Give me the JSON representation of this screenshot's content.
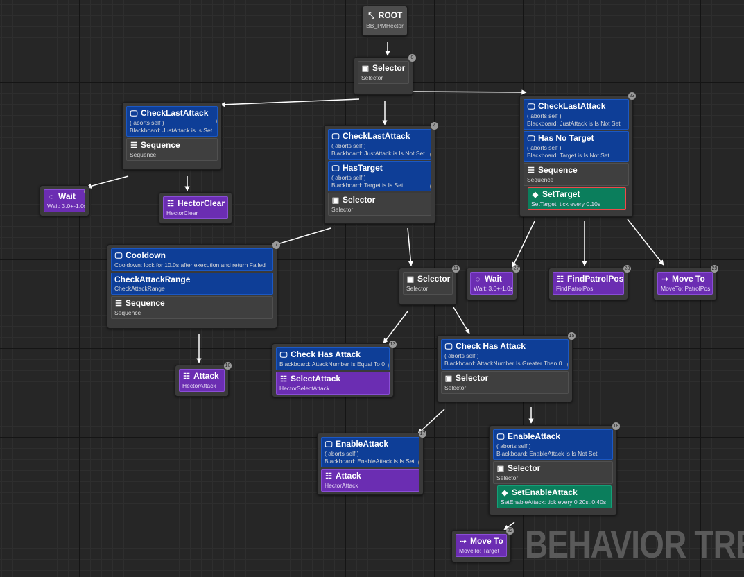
{
  "watermark": "BEHAVIOR TREE",
  "icons": {
    "root": "root-arrows-icon",
    "decorator": "monitor-icon",
    "selector": "selector-box-icon",
    "sequence": "sequence-bars-icon",
    "wait": "spinner-icon",
    "task": "task-list-icon",
    "move": "dotted-arrow-icon",
    "service": "service-icon"
  },
  "colors": {
    "decorator": "#0e3e97",
    "task": "#6b2db2",
    "service": "#0b7e5c",
    "composite": "#3f3f3f"
  },
  "nodes": {
    "root": {
      "title": "ROOT",
      "sub": "BB_PMHector"
    },
    "sel0": {
      "title": "Selector",
      "sub": "Selector",
      "badge": "0"
    },
    "left": {
      "d1": {
        "title": "CheckLastAttack",
        "aborts": "( aborts self )",
        "sub": "Blackboard: JustAttack is Is Set",
        "badge": "1"
      },
      "comp": {
        "title": "Sequence",
        "sub": "Sequence"
      }
    },
    "wait1": {
      "title": "Wait",
      "sub": "Wait: 3.0+-1.0s",
      "badge": "2"
    },
    "hectorclear": {
      "title": "HectorClear",
      "sub": "HectorClear",
      "badge": "3"
    },
    "mid": {
      "d1": {
        "title": "CheckLastAttack",
        "aborts": "( aborts self )",
        "sub": "Blackboard: JustAttack is Is Not Set",
        "badge": "5"
      },
      "d2": {
        "title": "HasTarget",
        "aborts": "( aborts self )",
        "sub": "Blackboard: Target is Is Set",
        "badge": "6"
      },
      "comp": {
        "title": "Selector",
        "sub": "Selector",
        "badge": "4"
      }
    },
    "cool": {
      "d1": {
        "title": "Cooldown",
        "sub": "Cooldown: lock for 10.0s after execution and return Failed",
        "badge": "8"
      },
      "d2": {
        "title": "CheckAttackRange",
        "sub": "CheckAttackRange",
        "badge": "9"
      },
      "comp": {
        "title": "Sequence",
        "sub": "Sequence",
        "badge": "7"
      }
    },
    "attack1": {
      "title": "Attack",
      "sub": "HectorAttack",
      "badge": "10"
    },
    "sel2": {
      "title": "Selector",
      "sub": "Selector",
      "badge": "11"
    },
    "cha1": {
      "d1": {
        "title": "Check Has Attack",
        "sub": "Blackboard: AttackNumber Is Equal To 0",
        "badge": "13"
      },
      "task": {
        "title": "SelectAttack",
        "sub": "HectorSelectAttack",
        "badge": "12"
      }
    },
    "cha2": {
      "d1": {
        "title": "Check Has Attack",
        "aborts": "( aborts self )",
        "sub": "Blackboard: AttackNumber Is Greater Than 0",
        "badge": "15"
      },
      "comp": {
        "title": "Selector",
        "sub": "Selector",
        "badge": "14"
      }
    },
    "ea1": {
      "d1": {
        "title": "EnableAttack",
        "aborts": "( aborts self )",
        "sub": "Blackboard: EnableAttack is Is Set",
        "badge": "17"
      },
      "task": {
        "title": "Attack",
        "sub": "HectorAttack",
        "badge": "16"
      }
    },
    "ea2": {
      "d1": {
        "title": "EnableAttack",
        "aborts": "( aborts self )",
        "sub": "Blackboard: EnableAttack is Is Not Set",
        "badge": "20"
      },
      "comp": {
        "title": "Selector",
        "sub": "Selector",
        "badge": "21"
      },
      "svc": {
        "title": "SetEnableAttack",
        "sub": "SetEnableAttack: tick every 0.20s..0.40s"
      },
      "cbadge": "18"
    },
    "moveto2": {
      "title": "Move To",
      "sub": "MoveTo: Target",
      "badge": "22"
    },
    "right": {
      "d1": {
        "title": "CheckLastAttack",
        "aborts": "( aborts self )",
        "sub": "Blackboard: JustAttack is Is Not Set",
        "badge": "24"
      },
      "d2": {
        "title": "Has No Target",
        "aborts": "( aborts self )",
        "sub": "Blackboard: Target is Is Not Set",
        "badge": "25"
      },
      "comp": {
        "title": "Sequence",
        "sub": "Sequence",
        "badge": "26"
      },
      "svc": {
        "title": "SetTarget",
        "sub": "SetTarget: tick every 0.10s"
      },
      "cbadge": "23"
    },
    "wait2": {
      "title": "Wait",
      "sub": "Wait: 3.0+-1.0s",
      "badge": "27"
    },
    "findpatrol": {
      "title": "FindPatrolPos",
      "sub": "FindPatrolPos",
      "badge": "28"
    },
    "moveto1": {
      "title": "Move To",
      "sub": "MoveTo: PatrolPos",
      "badge": "29"
    }
  }
}
